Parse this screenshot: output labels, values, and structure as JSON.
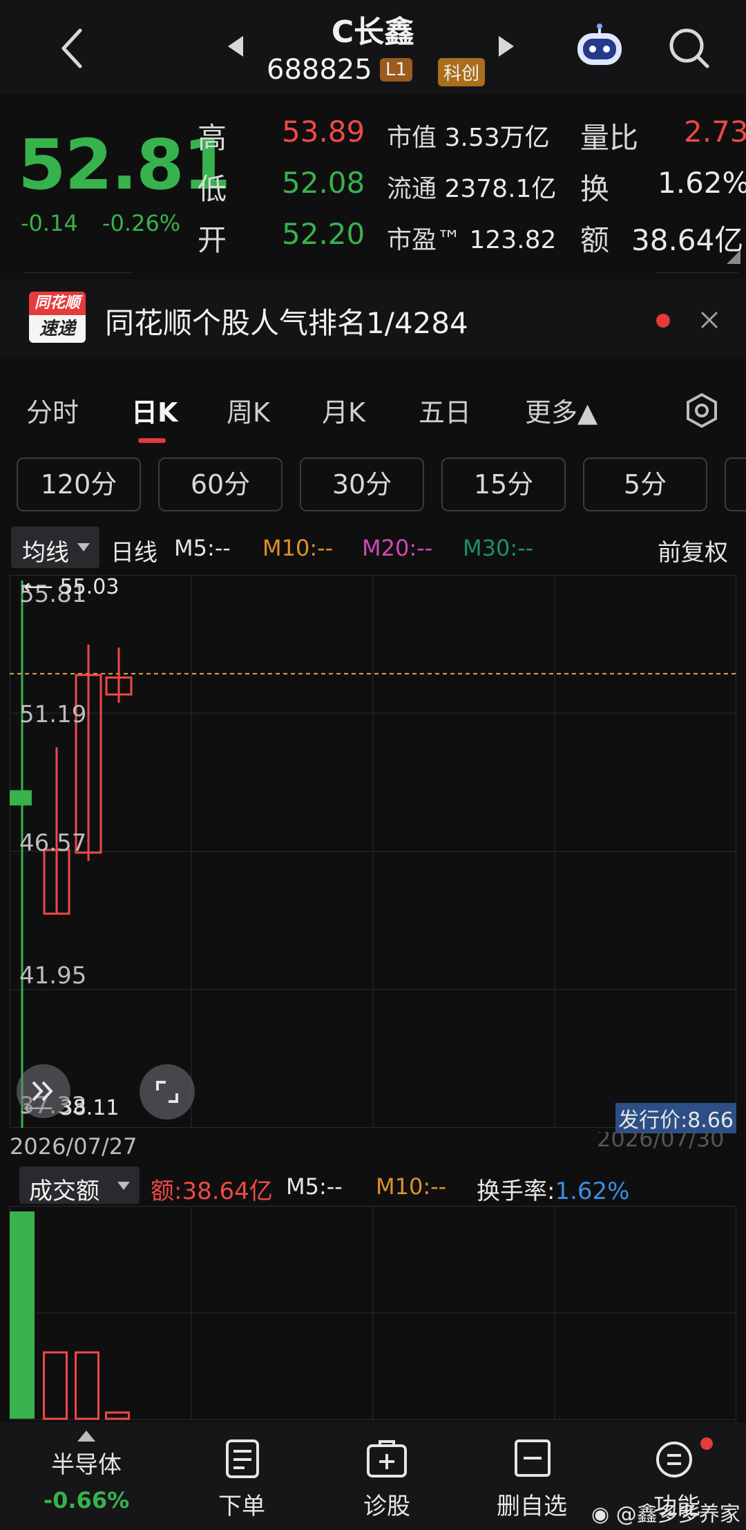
{
  "header": {
    "stock_name": "C长鑫",
    "stock_code": "688825",
    "badge_l1": "L1",
    "badge_board": "科创"
  },
  "quote": {
    "price": "52.81",
    "change": "-0.14",
    "change_pct": "-0.26%",
    "high_label": "高",
    "high_value": "53.89",
    "low_label": "低",
    "low_value": "52.08",
    "open_label": "开",
    "open_value": "52.20",
    "mcap_label": "市值",
    "mcap_value": "3.53万亿",
    "float_label": "流通",
    "float_value": "2378.1亿",
    "pe_label": "市盈™",
    "pe_value": "123.82",
    "vr_label": "量比",
    "vr_value": "2.73",
    "turnover_label": "换",
    "turnover_value": "1.62%",
    "amount_label": "额",
    "amount_value": "38.64亿"
  },
  "banner": {
    "logo_top": "同花顺",
    "logo_bottom": "速递",
    "text": "同花顺个股人气排名1/4284"
  },
  "tabs": [
    {
      "label": "分时"
    },
    {
      "label": "日K"
    },
    {
      "label": "周K"
    },
    {
      "label": "月K"
    },
    {
      "label": "五日"
    },
    {
      "label": "更多▲"
    }
  ],
  "periods": [
    {
      "label": "120分"
    },
    {
      "label": "60分"
    },
    {
      "label": "30分"
    },
    {
      "label": "15分"
    },
    {
      "label": "5分"
    }
  ],
  "indicator_bar": {
    "selector": "均线",
    "line_type": "日线",
    "m5": "M5:--",
    "m10": "M10:--",
    "m20": "M20:--",
    "m30": "M30:--",
    "adjust": "前复权"
  },
  "chart_data": {
    "type": "candlestick",
    "y_ticks": [
      "55.81",
      "51.19",
      "46.57",
      "41.95",
      "37.33"
    ],
    "ylim": [
      37.33,
      55.81
    ],
    "max_marker": "55.03",
    "min_marker": "38.11",
    "issue_price": "发行价:8.66",
    "date_left": "2026/07/27",
    "date_right": "2026/07/30",
    "reference_price": 52.95,
    "candles": [
      {
        "open": 48.5,
        "close": 48.5,
        "high": 48.5,
        "low": 48.5,
        "color": "green"
      },
      {
        "open": 44.3,
        "close": 46.6,
        "high": 50.3,
        "low": 44.3,
        "color": "red"
      },
      {
        "open": 46.5,
        "close": 52.9,
        "high": 54.0,
        "low": 46.2,
        "color": "red"
      },
      {
        "open": 52.2,
        "close": 52.81,
        "high": 53.89,
        "low": 51.9,
        "color": "red"
      }
    ]
  },
  "volume": {
    "selector": "成交额",
    "amount": "额:38.64亿",
    "m5": "M5:--",
    "m10": "M10:--",
    "turnover_label": "换手率:",
    "turnover_value": "1.62%",
    "bars": [
      {
        "value": 100,
        "color": "green"
      },
      {
        "value": 32,
        "color": "red"
      },
      {
        "value": 32,
        "color": "red"
      },
      {
        "value": 3,
        "color": "red"
      }
    ]
  },
  "bottom_nav": [
    {
      "label": "半导体",
      "sub": "-0.66%"
    },
    {
      "label": "下单"
    },
    {
      "label": "诊股"
    },
    {
      "label": "删自选"
    },
    {
      "label": "功能"
    }
  ],
  "watermark": "@鑫多多养家",
  "colors": {
    "up": "#f04848",
    "down": "#37b24d",
    "m10": "#e0902a",
    "m20": "#d04bb3",
    "m30": "#1f8f6a",
    "accent": "#e53b3b",
    "blue": "#3a8fe0"
  }
}
